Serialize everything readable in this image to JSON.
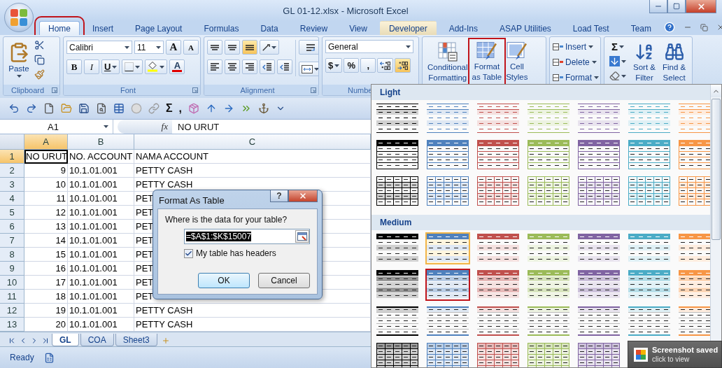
{
  "window": {
    "title": "GL 01-12.xlsx - Microsoft Excel"
  },
  "tabs": [
    {
      "label": "Home",
      "selected": true,
      "highlighted": false,
      "marked": true
    },
    {
      "label": "Insert",
      "selected": false,
      "highlighted": false,
      "marked": false
    },
    {
      "label": "Page Layout",
      "selected": false,
      "highlighted": false,
      "marked": false
    },
    {
      "label": "Formulas",
      "selected": false,
      "highlighted": false,
      "marked": false
    },
    {
      "label": "Data",
      "selected": false,
      "highlighted": false,
      "marked": false
    },
    {
      "label": "Review",
      "selected": false,
      "highlighted": false,
      "marked": false
    },
    {
      "label": "View",
      "selected": false,
      "highlighted": false,
      "marked": false
    },
    {
      "label": "Developer",
      "selected": false,
      "highlighted": true,
      "marked": false
    },
    {
      "label": "Add-Ins",
      "selected": false,
      "highlighted": false,
      "marked": false
    },
    {
      "label": "ASAP Utilities",
      "selected": false,
      "highlighted": false,
      "marked": false
    },
    {
      "label": "Load Test",
      "selected": false,
      "highlighted": false,
      "marked": false
    },
    {
      "label": "Team",
      "selected": false,
      "highlighted": false,
      "marked": false
    }
  ],
  "ribbon": {
    "clipboard": {
      "label": "Clipboard",
      "paste": "Paste"
    },
    "font": {
      "label": "Font",
      "font_name": "Calibri",
      "font_size": "11",
      "grow": "A",
      "shrink": "A",
      "bold": "B",
      "italic": "I",
      "underline": "U",
      "font_color": "A"
    },
    "alignment": {
      "label": "Alignment",
      "vertical": [
        {
          "selected": false
        },
        {
          "selected": false
        },
        {
          "selected": true
        }
      ]
    },
    "number": {
      "label": "Numbe",
      "format": "General",
      "currency": "$",
      "percent": "%",
      "comma": ",",
      "decrease_decimal_highlighted": true
    },
    "styles": {
      "conditional": [
        "Conditional",
        "Formatting"
      ],
      "format_table": [
        "Format",
        "as Table"
      ],
      "format_table_marked": true,
      "cell_styles": [
        "Cell",
        "Styles"
      ]
    },
    "cells": [
      "Insert",
      "Delete",
      "Format"
    ],
    "editing": {
      "sum": "Σ",
      "sort": [
        "Sort &",
        "Filter"
      ],
      "find": [
        "Find &",
        "Select"
      ]
    }
  },
  "quick_access": {
    "sum": "Σ",
    "comma": ","
  },
  "formula_bar": {
    "name_box": "A1",
    "fx": "fx",
    "value": "NO URUT"
  },
  "sheet": {
    "columns": [
      {
        "label": "A",
        "selected": true
      },
      {
        "label": "B",
        "selected": false
      },
      {
        "label": "C",
        "selected": false
      }
    ],
    "rows": [
      {
        "header": "1",
        "selected": true,
        "cells": [
          "NO URUT",
          "NO. ACCOUNT",
          "NAMA ACCOUNT"
        ]
      },
      {
        "header": "2",
        "selected": false,
        "cells": [
          "9",
          "10.1.01.001",
          "PETTY CASH"
        ]
      },
      {
        "header": "3",
        "selected": false,
        "cells": [
          "10",
          "10.1.01.001",
          "PETTY CASH"
        ]
      },
      {
        "header": "4",
        "selected": false,
        "cells": [
          "11",
          "10.1.01.001",
          "PET"
        ]
      },
      {
        "header": "5",
        "selected": false,
        "cells": [
          "12",
          "10.1.01.001",
          "PET"
        ]
      },
      {
        "header": "6",
        "selected": false,
        "cells": [
          "13",
          "10.1.01.001",
          "PET"
        ]
      },
      {
        "header": "7",
        "selected": false,
        "cells": [
          "14",
          "10.1.01.001",
          "PET"
        ]
      },
      {
        "header": "8",
        "selected": false,
        "cells": [
          "15",
          "10.1.01.001",
          "PET"
        ]
      },
      {
        "header": "9",
        "selected": false,
        "cells": [
          "16",
          "10.1.01.001",
          "PET"
        ]
      },
      {
        "header": "10",
        "selected": false,
        "cells": [
          "17",
          "10.1.01.001",
          "PET"
        ]
      },
      {
        "header": "11",
        "selected": false,
        "cells": [
          "18",
          "10.1.01.001",
          "PET"
        ]
      },
      {
        "header": "12",
        "selected": false,
        "cells": [
          "19",
          "10.1.01.001",
          "PETTY CASH"
        ]
      },
      {
        "header": "13",
        "selected": false,
        "cells": [
          "20",
          "10.1.01.001",
          "PETTY CASH"
        ]
      }
    ]
  },
  "sheet_tabs": [
    {
      "label": "GL",
      "selected": true
    },
    {
      "label": "COA",
      "selected": false
    },
    {
      "label": "Sheet3",
      "selected": false
    }
  ],
  "status_bar": {
    "text": "Ready"
  },
  "dialog": {
    "title": "Format As Table",
    "help": "?",
    "prompt": "Where is the data for your table?",
    "range": {
      "value": "=$A$1:$K$15007",
      "selected": true
    },
    "headers": {
      "label": "My table has headers",
      "checked": true
    },
    "buttons": [
      "OK",
      "Cancel"
    ]
  },
  "gallery": {
    "sections": [
      {
        "title": "Light",
        "rows": [
          {
            "kind": "lines",
            "styles": [
              {
                "color": "#000000",
                "hovered": false,
                "marked": false
              },
              {
                "color": "#4f81bd",
                "hovered": false,
                "marked": false
              },
              {
                "color": "#c0504d",
                "hovered": false,
                "marked": false
              },
              {
                "color": "#9bbb59",
                "hovered": false,
                "marked": false
              },
              {
                "color": "#8064a2",
                "hovered": false,
                "marked": false
              },
              {
                "color": "#4bacc6",
                "hovered": false,
                "marked": false
              },
              {
                "color": "#f79646",
                "hovered": false,
                "marked": false
              }
            ]
          },
          {
            "kind": "header",
            "styles": [
              {
                "color": "#000000",
                "hovered": false,
                "marked": false
              },
              {
                "color": "#4f81bd",
                "hovered": false,
                "marked": false
              },
              {
                "color": "#c0504d",
                "hovered": false,
                "marked": false
              },
              {
                "color": "#9bbb59",
                "hovered": false,
                "marked": false
              },
              {
                "color": "#8064a2",
                "hovered": false,
                "marked": false
              },
              {
                "color": "#4bacc6",
                "hovered": false,
                "marked": false
              },
              {
                "color": "#f79646",
                "hovered": false,
                "marked": false
              }
            ]
          },
          {
            "kind": "grid",
            "styles": [
              {
                "color": "#000000",
                "hovered": false,
                "marked": false
              },
              {
                "color": "#4f81bd",
                "hovered": false,
                "marked": false
              },
              {
                "color": "#c0504d",
                "hovered": false,
                "marked": false
              },
              {
                "color": "#9bbb59",
                "hovered": false,
                "marked": false
              },
              {
                "color": "#8064a2",
                "hovered": false,
                "marked": false
              },
              {
                "color": "#4bacc6",
                "hovered": false,
                "marked": false
              },
              {
                "color": "#f79646",
                "hovered": false,
                "marked": false
              }
            ]
          }
        ]
      },
      {
        "title": "Medium",
        "rows": [
          {
            "kind": "header-banded",
            "styles": [
              {
                "color": "#000000",
                "hovered": false,
                "marked": false
              },
              {
                "color": "#4f81bd",
                "hovered": true,
                "marked": false
              },
              {
                "color": "#c0504d",
                "hovered": false,
                "marked": false
              },
              {
                "color": "#9bbb59",
                "hovered": false,
                "marked": false
              },
              {
                "color": "#8064a2",
                "hovered": false,
                "marked": false
              },
              {
                "color": "#4bacc6",
                "hovered": false,
                "marked": false
              },
              {
                "color": "#f79646",
                "hovered": false,
                "marked": false
              }
            ]
          },
          {
            "kind": "filled",
            "styles": [
              {
                "color": "#000000",
                "hovered": false,
                "marked": false
              },
              {
                "color": "#4f81bd",
                "hovered": false,
                "marked": true
              },
              {
                "color": "#c0504d",
                "hovered": false,
                "marked": false
              },
              {
                "color": "#9bbb59",
                "hovered": false,
                "marked": false
              },
              {
                "color": "#8064a2",
                "hovered": false,
                "marked": false
              },
              {
                "color": "#4bacc6",
                "hovered": false,
                "marked": false
              },
              {
                "color": "#f79646",
                "hovered": false,
                "marked": false
              }
            ]
          },
          {
            "kind": "lines-header",
            "styles": [
              {
                "color": "#000000",
                "hovered": false,
                "marked": false
              },
              {
                "color": "#4f81bd",
                "hovered": false,
                "marked": false
              },
              {
                "color": "#c0504d",
                "hovered": false,
                "marked": false
              },
              {
                "color": "#9bbb59",
                "hovered": false,
                "marked": false
              },
              {
                "color": "#8064a2",
                "hovered": false,
                "marked": false
              },
              {
                "color": "#4bacc6",
                "hovered": false,
                "marked": false
              },
              {
                "color": "#f79646",
                "hovered": false,
                "marked": false
              }
            ]
          },
          {
            "kind": "grid-filled",
            "styles": [
              {
                "color": "#000000",
                "hovered": false,
                "marked": false
              },
              {
                "color": "#4f81bd",
                "hovered": false,
                "marked": false
              },
              {
                "color": "#c0504d",
                "hovered": false,
                "marked": false
              },
              {
                "color": "#9bbb59",
                "hovered": false,
                "marked": false
              },
              {
                "color": "#8064a2",
                "hovered": false,
                "marked": false
              }
            ]
          }
        ]
      }
    ]
  },
  "toast": {
    "title": "Screenshot saved",
    "subtitle": "click to view"
  }
}
